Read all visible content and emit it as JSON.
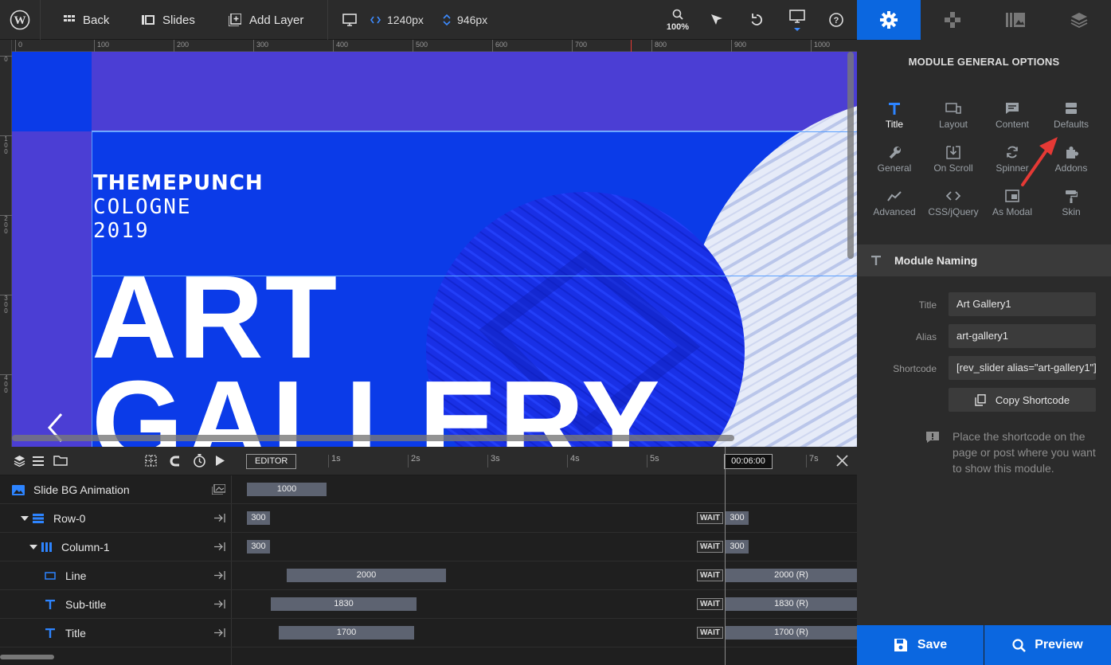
{
  "toolbar": {
    "back_label": "Back",
    "slides_label": "Slides",
    "add_layer_label": "Add Layer",
    "width_value": "1240px",
    "height_value": "946px",
    "zoom_value": "100%"
  },
  "ruler": {
    "top_ticks": [
      "0",
      "100",
      "200",
      "300",
      "400",
      "500",
      "600",
      "700",
      "800",
      "900",
      "1000"
    ],
    "left_ticks": [
      "0",
      "1\n0\n0",
      "2\n0\n0",
      "3\n0\n0",
      "4\n0\n0"
    ]
  },
  "canvas": {
    "brand_name": "THEMEPUNCH",
    "brand_city": "COLOGNE",
    "brand_year": "2019",
    "title_line1": "ART",
    "title_line2": "GALLERY"
  },
  "timeline": {
    "editor_label": "EDITOR",
    "seconds": [
      "1s",
      "2s",
      "3s",
      "4s",
      "5s",
      "7s"
    ],
    "current_time": "00:06:00",
    "wait_label": "WAIT",
    "rows": [
      {
        "name": "Slide BG Animation",
        "start": "1000"
      },
      {
        "name": "Row-0",
        "start": "300",
        "end": "300"
      },
      {
        "name": "Column-1",
        "start": "300",
        "end": "300"
      },
      {
        "name": "Line",
        "start": "2000",
        "end": "2000 (R)"
      },
      {
        "name": "Sub-title",
        "start": "1830",
        "end": "1830 (R)"
      },
      {
        "name": "Title",
        "start": "1700",
        "end": "1700 (R)"
      }
    ]
  },
  "panel": {
    "title": "MODULE GENERAL OPTIONS",
    "options": [
      "Title",
      "Layout",
      "Content",
      "Defaults",
      "General",
      "On Scroll",
      "Spinner",
      "Addons",
      "Advanced",
      "CSS/jQuery",
      "As Modal",
      "Skin"
    ],
    "section_title": "Module Naming",
    "fields": {
      "title_label": "Title",
      "title_value": "Art Gallery1",
      "alias_label": "Alias",
      "alias_value": "art-gallery1",
      "shortcode_label": "Shortcode",
      "shortcode_value": "[rev_slider alias=\"art-gallery1\"]"
    },
    "copy_label": "Copy Shortcode",
    "hint": "Place the shortcode on the page or post where you want to show this module."
  },
  "footer": {
    "save_label": "Save",
    "preview_label": "Preview"
  },
  "colors": {
    "accent": "#0b67e0",
    "canvas_blue": "#0b3be8",
    "row_purple": "#4b3ed4",
    "annotation_red": "#e53935"
  }
}
